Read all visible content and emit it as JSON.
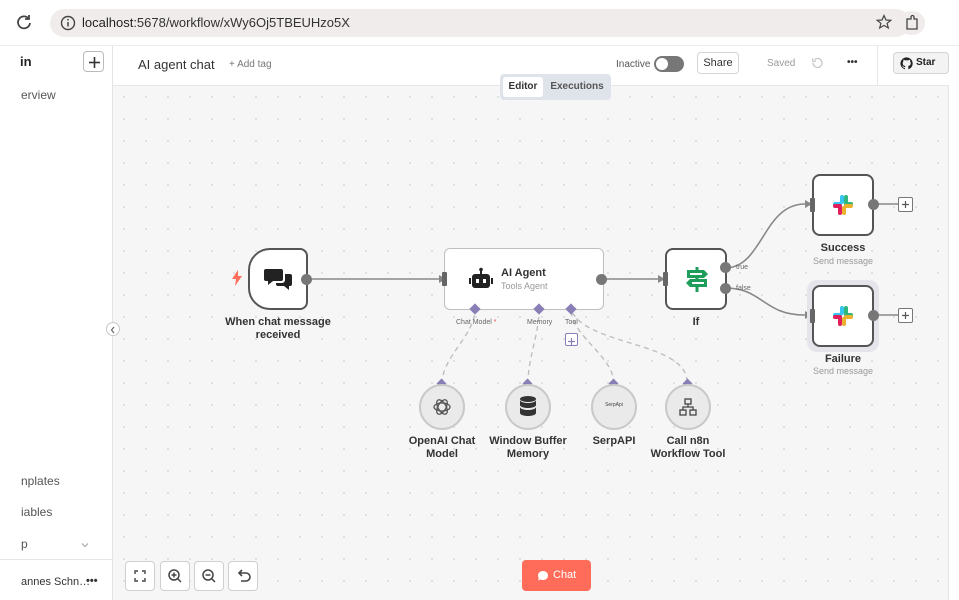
{
  "browser": {
    "url_host": "localhost",
    "url_rest": ":5678/workflow/xWy6Oj5TBEUHzo5X"
  },
  "sidebar": {
    "logo_text": "in",
    "items": {
      "overview": "erview",
      "templates": "nplates",
      "variables": "iables",
      "help": "p"
    },
    "user": "annes Schn…"
  },
  "header": {
    "title": "AI agent chat",
    "add_tag": "+ Add tag",
    "status": "Inactive",
    "share": "Share",
    "saved": "Saved",
    "more": "•••",
    "star": "Star"
  },
  "tabs": {
    "editor": "Editor",
    "executions": "Executions"
  },
  "nodes": {
    "trigger": {
      "label": "When chat message received"
    },
    "agent": {
      "title": "AI Agent",
      "subtitle": "Tools Agent",
      "handle_chat_model": "Chat Model",
      "handle_memory": "Memory",
      "handle_tool": "Tool",
      "required_mark": "*"
    },
    "if": {
      "label": "If",
      "out_true": "true",
      "out_false": "false"
    },
    "success": {
      "label": "Success",
      "sub": "Send message"
    },
    "failure": {
      "label": "Failure",
      "sub": "Send message"
    },
    "openai": {
      "label": "OpenAI Chat Model"
    },
    "memory": {
      "label": "Window Buffer Memory"
    },
    "serpapi": {
      "label": "SerpAPI",
      "icon_text": "SerpApi"
    },
    "workflow_tool": {
      "label": "Call n8n Workflow Tool"
    }
  },
  "chat_button": "Chat",
  "colors": {
    "accent": "#ff6d5a",
    "node_border": "#555555",
    "tab_active": "#ffffff",
    "tab_bar": "#dfe3ea",
    "if_green": "#1e9e5a",
    "slack_multi": [
      "#36c5f0",
      "#2eb67d",
      "#ecb22e",
      "#e01e5a"
    ]
  }
}
